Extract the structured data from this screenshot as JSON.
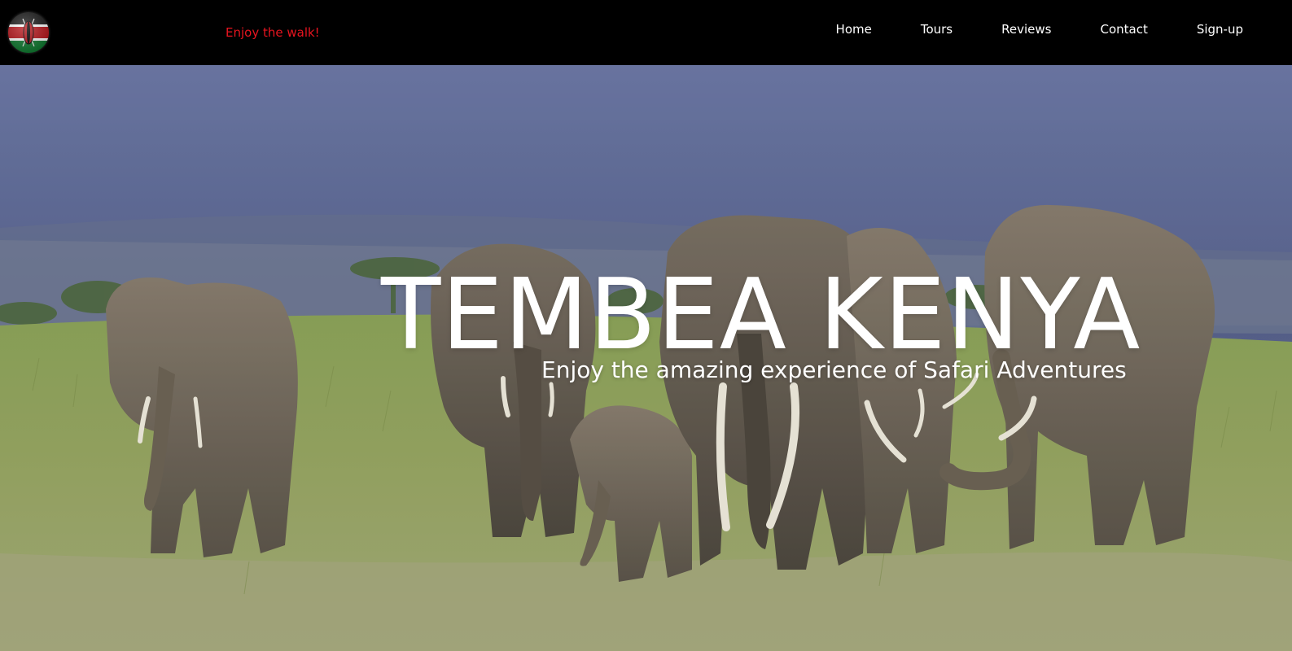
{
  "navbar": {
    "tagline": "Enjoy the walk!",
    "logo_icon": "kenya-flag-shield-icon",
    "links": [
      {
        "label": "Home"
      },
      {
        "label": "Tours"
      },
      {
        "label": "Reviews"
      },
      {
        "label": "Contact"
      },
      {
        "label": "Sign-up"
      }
    ]
  },
  "hero": {
    "title": "TEMBEA KENYA",
    "subtitle": "Enjoy the amazing experience of Safari Adventures",
    "background_image": "elephant-herd-savanna-photo"
  },
  "colors": {
    "navbar_bg": "#000000",
    "tagline": "#e8141f",
    "nav_text": "#ffffff",
    "hero_text": "#ffffff"
  }
}
